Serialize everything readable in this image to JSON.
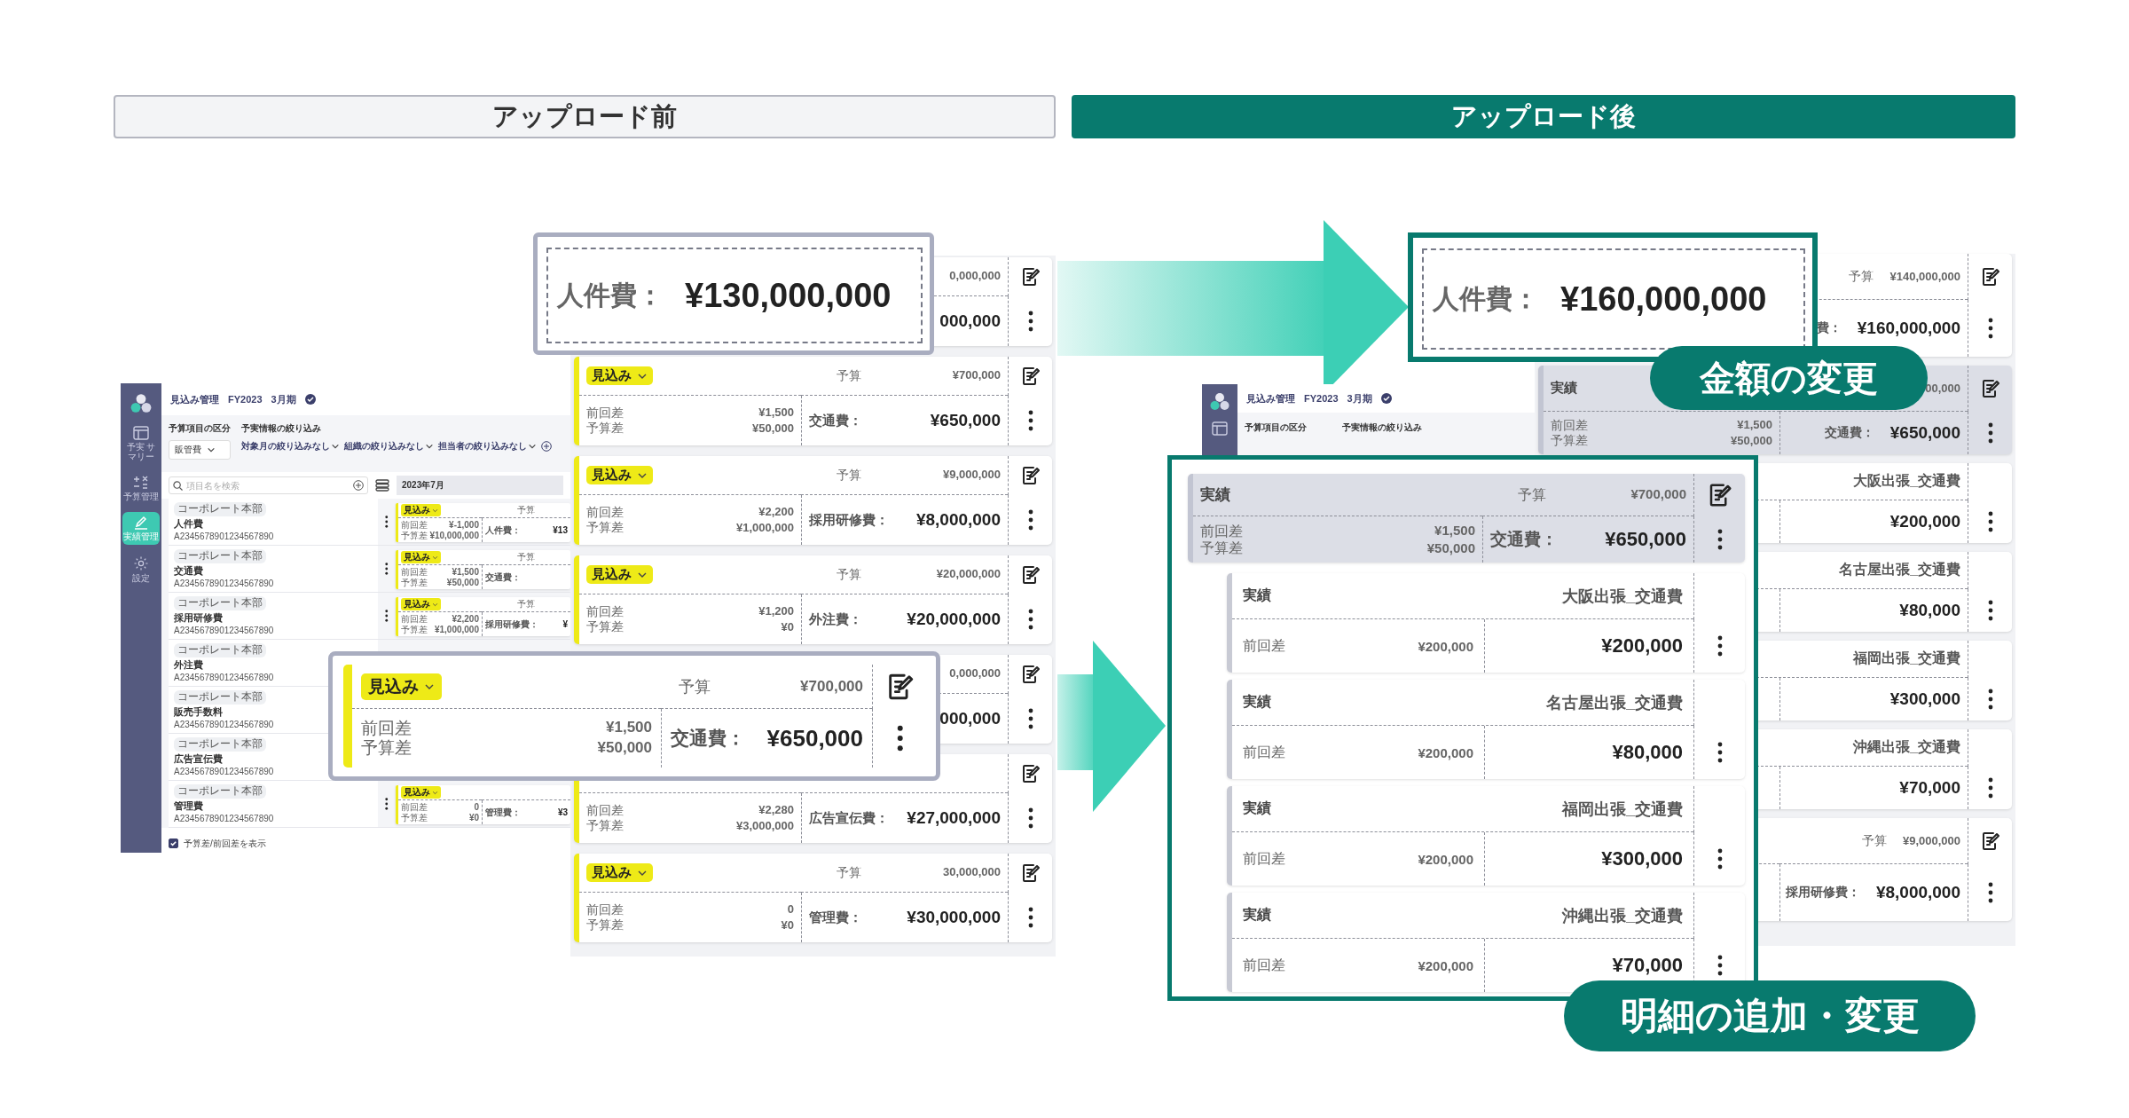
{
  "headers": [
    {
      "title": "アップロード前",
      "kind": "outline"
    },
    {
      "title": "アップロード後",
      "kind": "filled"
    }
  ],
  "before": {
    "app": {
      "breadcrumb": [
        "見込み管理",
        "FY2023",
        "3月期"
      ],
      "nav": [
        {
          "label": "予実 サマリー",
          "kind": "table",
          "selected": false
        },
        {
          "label": "予算管理",
          "kind": "calc",
          "selected": false
        },
        {
          "label": "実績管理",
          "kind": "edit",
          "selected": true
        },
        {
          "label": "設定",
          "kind": "gear",
          "selected": false
        }
      ],
      "category": {
        "label": "予算項目の区分",
        "value": "販管費"
      },
      "filter": {
        "label": "予実情報の絞り込み",
        "options": [
          "対象月の絞り込みなし",
          "組織の絞り込みなし",
          "担当者の絞り込みなし"
        ]
      },
      "search": {
        "placeholder": "項目名を検索"
      },
      "month": "2023年7月",
      "items": [
        {
          "org": "コーポレート本部",
          "name": "人件費",
          "code": "A2345678901234567890",
          "card": {
            "kind": "forecast",
            "tag": "見込み",
            "budget_label": "予算",
            "diff_labels": [
              "前回差",
              "予算差"
            ],
            "diffs": [
              "¥-1,000",
              "¥10,000,000"
            ],
            "item_label": "人件費：",
            "amount": "¥13"
          }
        },
        {
          "org": "コーポレート本部",
          "name": "交通費",
          "code": "A2345678901234567890",
          "card": {
            "kind": "forecast",
            "tag": "見込み",
            "budget_label": "予算",
            "diff_labels": [
              "前回差",
              "予算差"
            ],
            "diffs": [
              "¥1,500",
              "¥50,000"
            ],
            "item_label": "交通費："
          }
        },
        {
          "org": "コーポレート本部",
          "name": "採用研修費",
          "code": "A2345678901234567890",
          "card": {
            "kind": "forecast",
            "tag": "見込み",
            "budget_label": "予算",
            "diff_labels": [
              "前回差",
              "予算差"
            ],
            "diffs": [
              "¥2,200",
              "¥1,000,000"
            ],
            "item_label": "採用研修費：",
            "amount": "¥"
          }
        },
        {
          "org": "コーポレート本部",
          "name": "外注費",
          "code": "A2345678901234567890"
        },
        {
          "org": "コーポレート本部",
          "name": "販売手数料",
          "code": "A2345678901234567890"
        },
        {
          "org": "コーポレート本部",
          "name": "広告宣伝費",
          "code": "A2345678901234567890"
        },
        {
          "org": "コーポレート本部",
          "name": "管理費",
          "code": "A2345678901234567890",
          "card": {
            "kind": "forecast",
            "tag": "見込み",
            "diff_labels": [
              "前回差",
              "予算差"
            ],
            "diffs": [
              "0",
              "¥0"
            ],
            "item_label": "管理費：",
            "amount": "¥3"
          }
        }
      ],
      "show_diff": {
        "label": "予算差/前回差を表示",
        "checked": true
      }
    },
    "cards": [
      {
        "kind": "forecast",
        "budget": "0,000,000",
        "amount": "000,000"
      },
      {
        "kind": "forecast",
        "tag": "見込み",
        "budget_label": "予算",
        "budget": "¥700,000",
        "diff_labels": [
          "前回差",
          "予算差"
        ],
        "diffs": [
          "¥1,500",
          "¥50,000"
        ],
        "item_label": "交通費：",
        "amount": "¥650,000"
      },
      {
        "kind": "forecast",
        "tag": "見込み",
        "budget_label": "予算",
        "budget": "¥9,000,000",
        "diff_labels": [
          "前回差",
          "予算差"
        ],
        "diffs": [
          "¥2,200",
          "¥1,000,000"
        ],
        "item_label": "採用研修費：",
        "amount": "¥8,000,000"
      },
      {
        "kind": "forecast",
        "tag": "見込み",
        "budget_label": "予算",
        "budget": "¥20,000,000",
        "diff_labels": [
          "前回差",
          "予算差"
        ],
        "diffs": [
          "¥1,200",
          "¥0"
        ],
        "item_label": "外注費：",
        "amount": "¥20,000,000"
      },
      {
        "kind": "forecast",
        "budget": "0,000,000",
        "amount": "000,000"
      },
      {
        "kind": "forecast",
        "diff_labels": [
          "前回差",
          "予算差"
        ],
        "diffs": [
          "¥2,280",
          "¥3,000,000"
        ],
        "item_label": "広告宣伝費：",
        "amount": "¥27,000,000"
      },
      {
        "kind": "forecast",
        "tag": "見込み",
        "budget_label": "予算",
        "budget": "30,000,000",
        "diff_labels": [
          "前回差",
          "予算差"
        ],
        "diffs": [
          "0",
          "¥0"
        ],
        "item_label": "管理費：",
        "amount": "¥30,000,000"
      }
    ],
    "zoom": {
      "label": "人件費：",
      "amount": "¥130,000,000"
    },
    "popup": {
      "kind": "forecast",
      "tag": "見込み",
      "budget_label": "予算",
      "budget": "¥700,000",
      "diff_labels": [
        "前回差",
        "予算差"
      ],
      "diffs": [
        "¥1,500",
        "¥50,000"
      ],
      "item_label": "交通費：",
      "amount": "¥650,000"
    }
  },
  "after": {
    "app": {
      "breadcrumb": [
        "見込み管理",
        "FY2023",
        "3月期"
      ],
      "category_label": "予算項目の区分",
      "filter_label": "予実情報の絞り込み"
    },
    "cards": [
      {
        "kind": "forecast",
        "budget_label": "予算",
        "budget": "¥140,000,000",
        "item_label": "費：",
        "amount": "¥160,000,000"
      },
      {
        "kind": "actual",
        "tag": "実績",
        "budget": "00,000",
        "diff_labels": [
          "前回差",
          "予算差"
        ],
        "diffs": [
          "¥1,500",
          "¥50,000"
        ],
        "item_label": "交通費：",
        "amount": "¥650,000"
      },
      {
        "kind": "line",
        "name": "大阪出張_交通費",
        "amount": "¥200,000"
      },
      {
        "kind": "line",
        "name": "名古屋出張_交通費",
        "amount": "¥80,000"
      },
      {
        "kind": "line",
        "name": "福岡出張_交通費",
        "amount": "¥300,000"
      },
      {
        "kind": "line",
        "name": "沖縄出張_交通費",
        "amount": "¥70,000"
      },
      {
        "kind": "forecast",
        "budget_label": "予算",
        "budget": "¥9,000,000",
        "item_label": "採用研修費：",
        "amount": "¥8,000,000"
      }
    ],
    "zoom": {
      "label": "人件費：",
      "amount": "¥160,000,000"
    },
    "detail": {
      "parent": {
        "kind": "actual",
        "tag": "実績",
        "budget_label": "予算",
        "budget": "¥700,000",
        "diff_labels": [
          "前回差",
          "予算差"
        ],
        "diffs": [
          "¥1,500",
          "¥50,000"
        ],
        "item_label": "交通費：",
        "amount": "¥650,000"
      },
      "children": [
        {
          "kind": "line",
          "tag": "実績",
          "name": "大阪出張_交通費",
          "diff_labels": [
            "前回差"
          ],
          "diffs": [
            "¥200,000"
          ],
          "amount": "¥200,000"
        },
        {
          "kind": "line",
          "tag": "実績",
          "name": "名古屋出張_交通費",
          "diff_labels": [
            "前回差"
          ],
          "diffs": [
            "¥200,000"
          ],
          "amount": "¥80,000"
        },
        {
          "kind": "line",
          "tag": "実績",
          "name": "福岡出張_交通費",
          "diff_labels": [
            "前回差"
          ],
          "diffs": [
            "¥200,000"
          ],
          "amount": "¥300,000"
        },
        {
          "kind": "line",
          "tag": "実績",
          "name": "沖縄出張_交通費",
          "diff_labels": [
            "前回差"
          ],
          "diffs": [
            "¥200,000"
          ],
          "amount": "¥70,000"
        }
      ]
    },
    "badges": [
      "金額の変更",
      "明細の追加・変更"
    ]
  }
}
